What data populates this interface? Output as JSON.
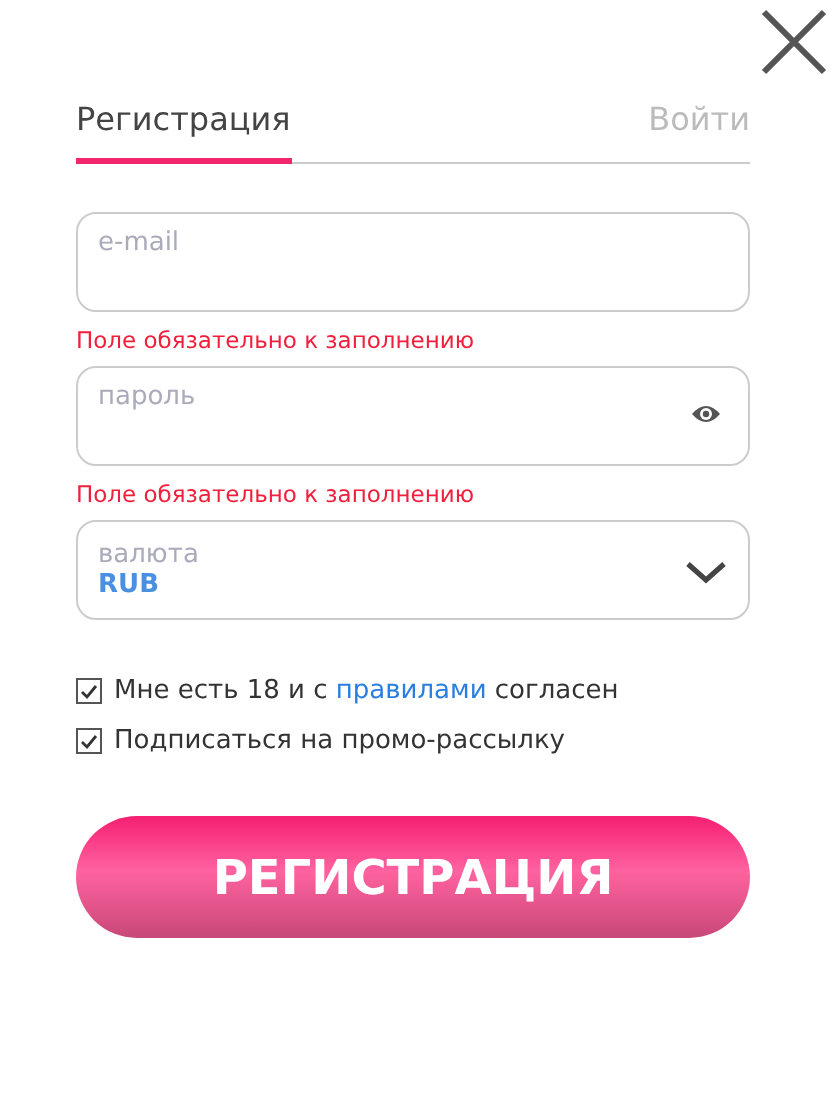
{
  "close": {
    "kind": "close"
  },
  "tabs": [
    {
      "label": "Регистрация",
      "selected": true
    },
    {
      "label": "Войти",
      "selected": false
    }
  ],
  "fields": [
    {
      "kind": "text",
      "placeholder": "e-mail",
      "error": "Поле обязательно к заполнению"
    },
    {
      "kind": "password",
      "placeholder": "пароль",
      "error": "Поле обязательно к заполнению"
    },
    {
      "kind": "select",
      "label": "валюта",
      "value": "RUB"
    }
  ],
  "checkboxes": [
    {
      "checked": true,
      "text_before": "Мне есть 18 и с ",
      "link": "правилами",
      "text_after": " согласен"
    },
    {
      "checked": true,
      "text_before": "Подписаться на промо-рассылку"
    }
  ],
  "submit": "РЕГИСТРАЦИЯ"
}
